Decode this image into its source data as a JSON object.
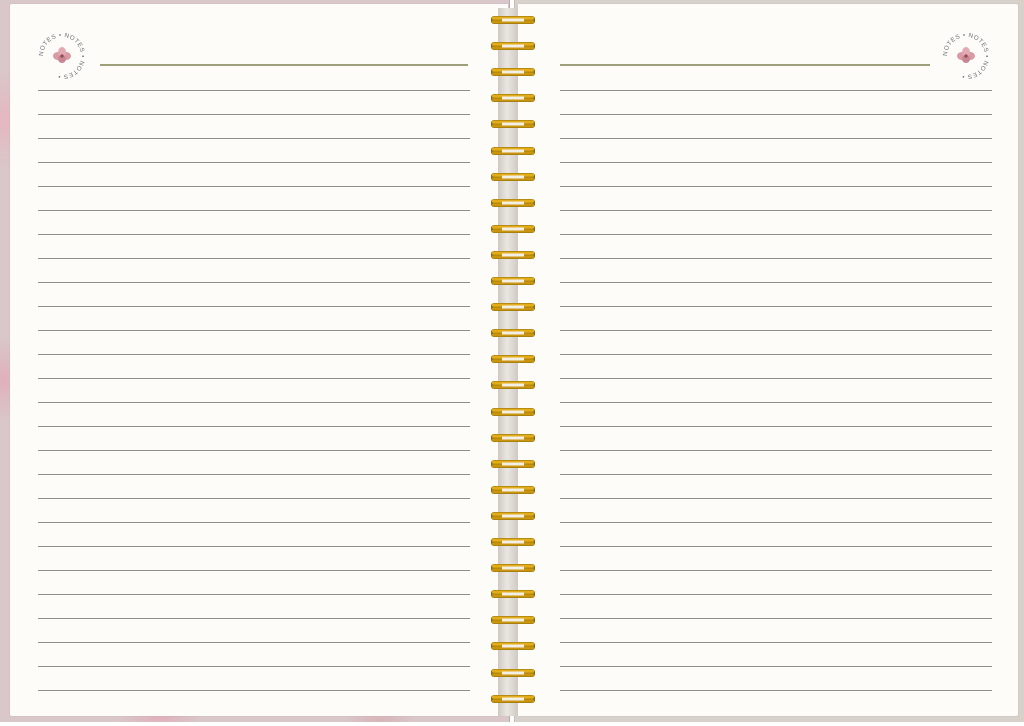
{
  "notebook": {
    "left_page": {
      "badge_text": "NOTES • NOTES • NOTES •",
      "ruled_line_count": 26
    },
    "right_page": {
      "badge_text": "NOTES • NOTES • NOTES •",
      "ruled_line_count": 26
    },
    "spiral_ring_count": 27
  },
  "colors": {
    "page": "#fdfcf9",
    "title_line": "#9ea07a",
    "rule_line": "#8e8f8a",
    "ring_gold": "#e2ad18",
    "flower_pink": "#d99aa4",
    "cover_left": "#d9c7c9",
    "cover_right": "#d8d1cb"
  },
  "icons": {
    "badge_flower": "flower-icon",
    "spiral": "spiral-ring-icon"
  }
}
